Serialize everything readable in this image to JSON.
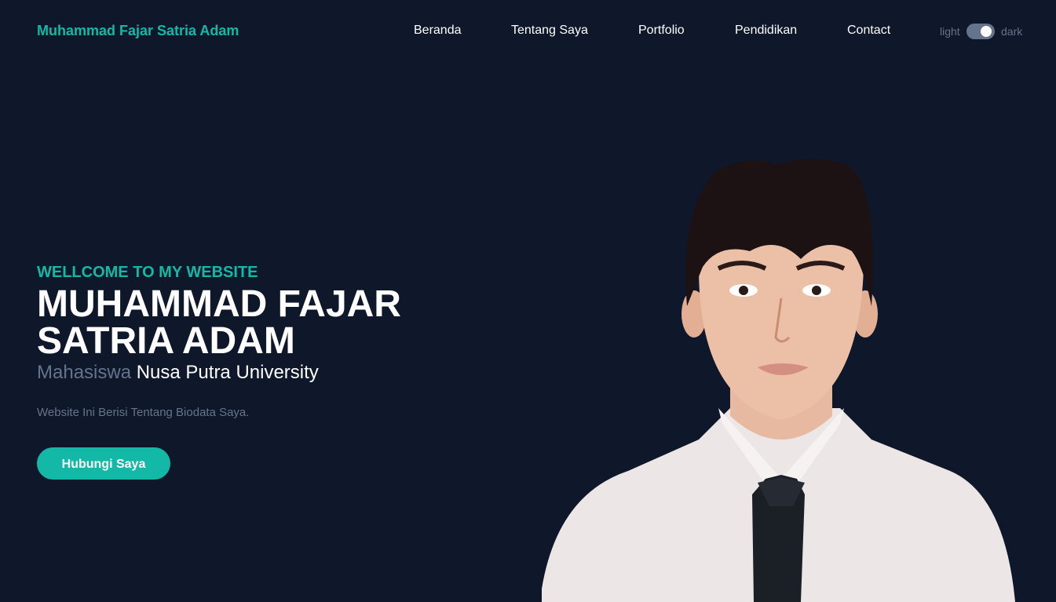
{
  "header": {
    "brand": "Muhammad Fajar Satria Adam",
    "nav": [
      "Beranda",
      "Tentang Saya",
      "Portfolio",
      "Pendidikan",
      "Contact"
    ],
    "toggle": {
      "light_label": "light",
      "dark_label": "dark",
      "mode": "dark"
    }
  },
  "hero": {
    "welcome": "WELLCOME TO MY WEBSITE",
    "name": "MUHAMMAD FAJAR SATRIA ADAM",
    "subtitle_role": "Mahasiswa",
    "subtitle_uni": "Nusa Putra University",
    "description": "Website Ini Berisi Tentang Biodata Saya.",
    "cta_label": "Hubungi Saya"
  },
  "colors": {
    "background": "#0f172a",
    "accent": "#14b8a6",
    "muted": "#64748b",
    "text": "#ffffff"
  }
}
